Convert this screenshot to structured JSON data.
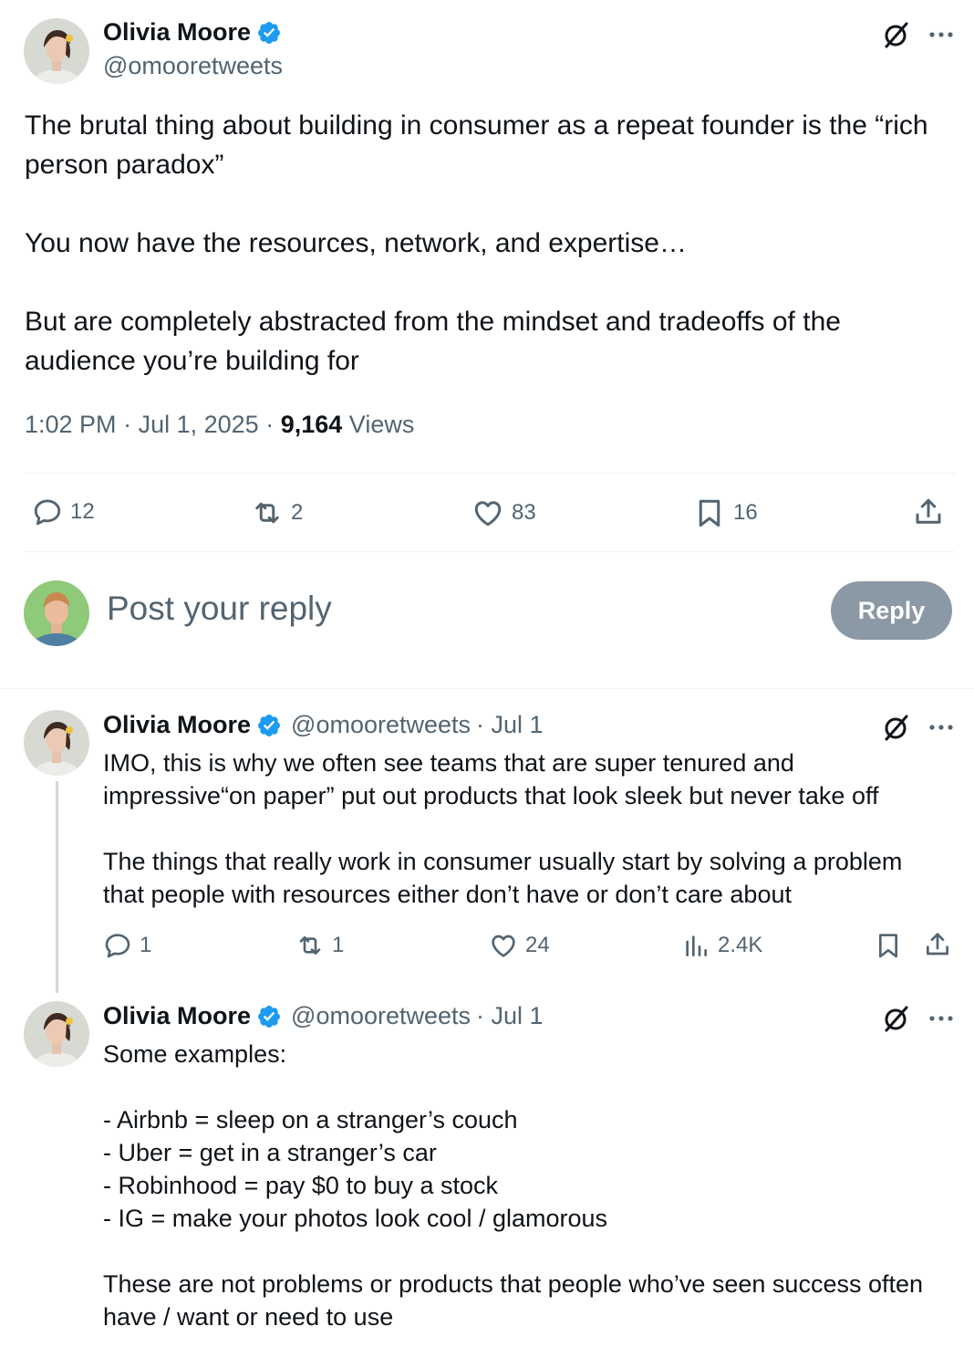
{
  "main_tweet": {
    "author_name": "Olivia Moore",
    "author_handle": "@omooretweets",
    "paragraphs": [
      "The brutal thing about building in consumer as a repeat founder is the “rich person paradox”",
      "You now have the resources, network, and expertise…",
      "But are completely abstracted from the mindset and tradeoffs of the audience you’re building for"
    ],
    "time": "1:02 PM",
    "date": "Jul 1, 2025",
    "views_count": "9,164",
    "views_label": "Views",
    "replies": "12",
    "reposts": "2",
    "likes": "83",
    "bookmarks": "16"
  },
  "compose": {
    "placeholder": "Post your reply",
    "button_label": "Reply"
  },
  "replies": [
    {
      "author_name": "Olivia Moore",
      "author_handle": "@omooretweets",
      "date": "· Jul 1",
      "paragraphs": [
        [
          "IMO, this is why we often see teams that are super tenured and",
          "impressive“on paper” put out products that look sleek but never take off"
        ],
        [
          "The things that really work in consumer usually start by solving a problem",
          "that people with resources either don’t have or don’t care about"
        ]
      ],
      "replies": "1",
      "reposts": "1",
      "likes": "24",
      "views": "2.4K"
    },
    {
      "author_name": "Olivia Moore",
      "author_handle": "@omooretweets",
      "date": "· Jul 1",
      "paragraphs": [
        [
          "Some examples:"
        ],
        [
          "- Airbnb = sleep on a stranger’s couch",
          "- Uber = get in a stranger’s car",
          "- Robinhood = pay $0 to buy a stock",
          "- IG = make your photos look cool / glamorous"
        ],
        [
          "These are not problems or products that people who’ve seen success often",
          "have / want or need to use"
        ]
      ]
    }
  ],
  "colors": {
    "verified": "#1d9bf0",
    "muted_text": "#536471",
    "reply_button": "#8b98a5"
  }
}
